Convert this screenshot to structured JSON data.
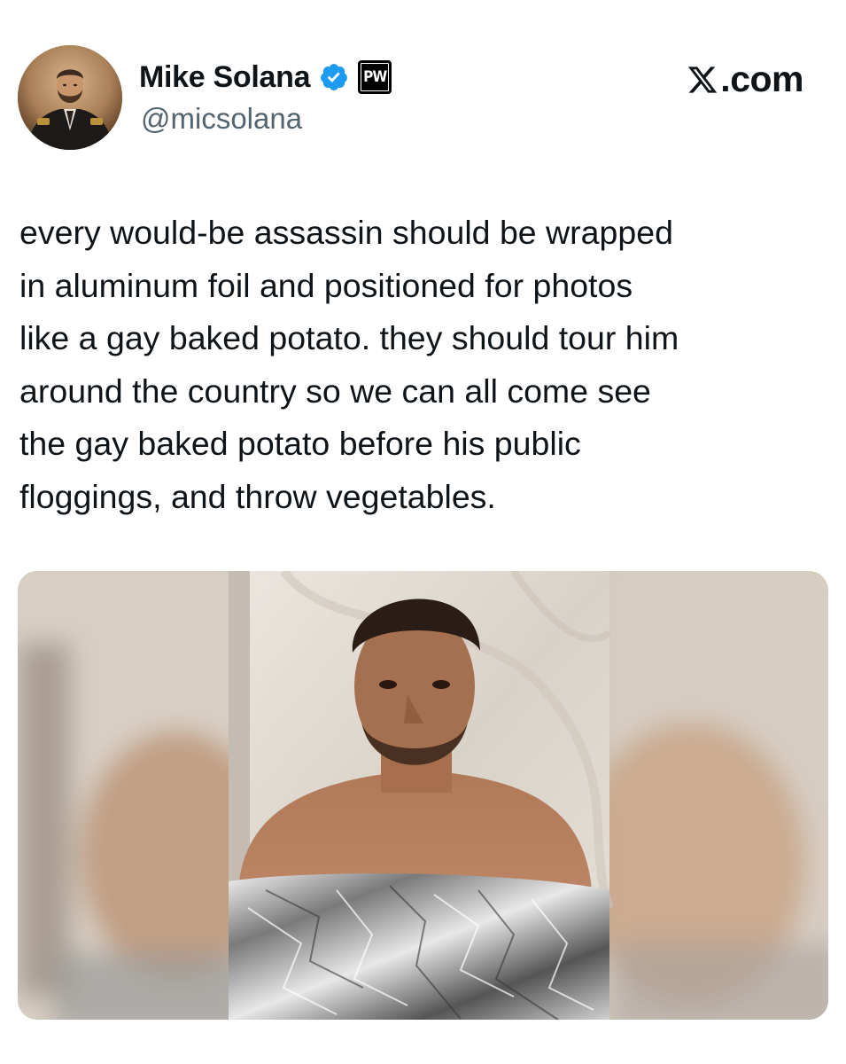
{
  "tweet": {
    "display_name": "Mike Solana",
    "handle": "@micsolana",
    "affiliation_badge": "PW",
    "site_label": ".com",
    "text": "every would-be assassin should be wrapped\nin aluminum foil and positioned for photos\nlike a gay baked potato. they should tour him\naround the country so we can all come see\nthe gay baked potato before his public\nfloggings, and throw vegetables."
  },
  "icons": {
    "verified": "verified-badge-icon",
    "site_logo": "x-logo-icon"
  },
  "colors": {
    "text": "#0f1419",
    "secondary_text": "#536471",
    "verified_blue": "#1d9bf0"
  }
}
